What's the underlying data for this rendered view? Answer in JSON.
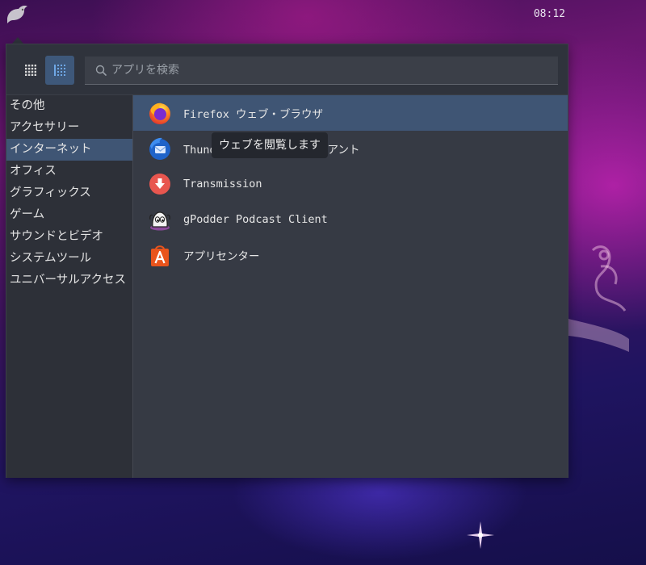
{
  "panel": {
    "clock": "08:12"
  },
  "search": {
    "placeholder": "アプリを検索"
  },
  "view_toggle": {
    "grid_icon": "grid-view-icon",
    "list_icon": "list-view-icon",
    "active": "list"
  },
  "categories": [
    {
      "label": "その他"
    },
    {
      "label": "アクセサリー"
    },
    {
      "label": "インターネット",
      "active": true
    },
    {
      "label": "オフィス"
    },
    {
      "label": "グラフィックス"
    },
    {
      "label": "ゲーム"
    },
    {
      "label": "サウンドとビデオ"
    },
    {
      "label": "システムツール"
    },
    {
      "label": "ユニバーサルアクセス"
    }
  ],
  "apps": [
    {
      "label": "Firefox ウェブ・ブラウザ",
      "icon": "firefox-icon",
      "active": true
    },
    {
      "label": "Thunderbird メールクライアント",
      "icon": "thunderbird-icon"
    },
    {
      "label": "Transmission",
      "icon": "transmission-icon"
    },
    {
      "label": "gPodder Podcast Client",
      "icon": "gpodder-icon"
    },
    {
      "label": "アプリセンター",
      "icon": "app-center-icon"
    }
  ],
  "tooltip": {
    "text": "ウェブを閲覧します"
  },
  "colors": {
    "accent": "#3f5574",
    "menu_bg": "#2f333c",
    "list_bg": "#363a44"
  }
}
